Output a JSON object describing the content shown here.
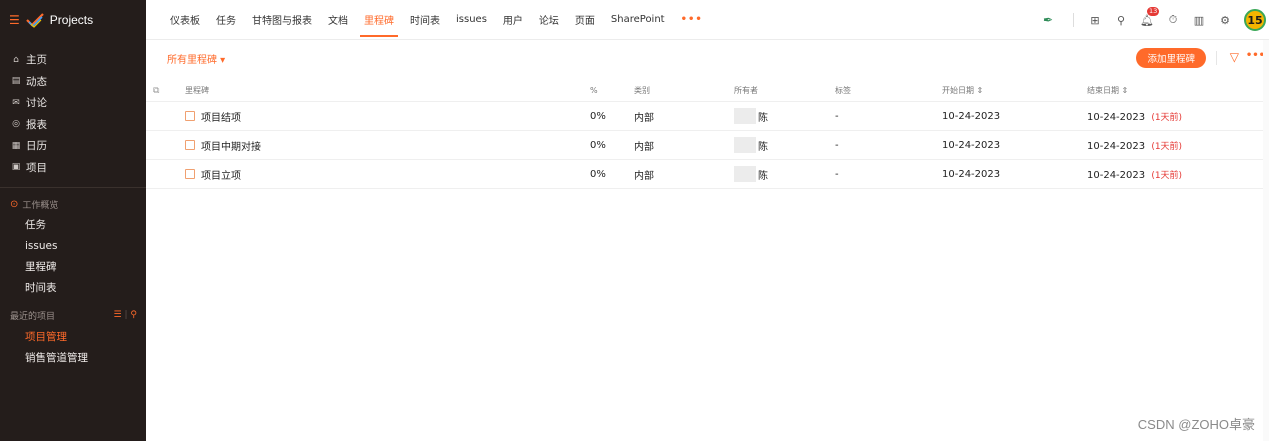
{
  "brand": {
    "name": "Projects"
  },
  "sidebar": {
    "nav": [
      {
        "icon": "home-icon",
        "glyph": "⌂",
        "label": "主页"
      },
      {
        "icon": "activity-icon",
        "glyph": "▤",
        "label": "动态"
      },
      {
        "icon": "discussion-icon",
        "glyph": "✉",
        "label": "讨论"
      },
      {
        "icon": "report-icon",
        "glyph": "◎",
        "label": "报表"
      },
      {
        "icon": "calendar-icon",
        "glyph": "▦",
        "label": "日历"
      },
      {
        "icon": "project-icon",
        "glyph": "▣",
        "label": "项目"
      }
    ],
    "work_overview": {
      "label": "工作概览",
      "items": [
        "任务",
        "issues",
        "里程碑",
        "时间表"
      ]
    },
    "recent": {
      "label": "最近的项目",
      "items": [
        "项目管理",
        "销售管道管理"
      ]
    }
  },
  "topnav": {
    "tabs": [
      "仪表板",
      "任务",
      "甘特图与报表",
      "文档",
      "里程碑",
      "时间表",
      "issues",
      "用户",
      "论坛",
      "页面",
      "SharePoint"
    ],
    "active": "里程碑",
    "more": "•••",
    "notification_count": "13",
    "avatar_text": "15"
  },
  "toolbar": {
    "filter_label": "所有里程碑 ▾",
    "add_button": "添加里程碑"
  },
  "table": {
    "headers": {
      "name": "里程碑",
      "percent": "%",
      "type": "类别",
      "owner": "所有者",
      "tags": "标签",
      "start": "开始日期 ⇕",
      "end": "结束日期 ⇕"
    },
    "rows": [
      {
        "name": "项目结项",
        "percent": "0%",
        "type": "内部",
        "owner": "陈",
        "tags": "-",
        "start": "10-24-2023",
        "end": "10-24-2023",
        "overdue": "(1天前)"
      },
      {
        "name": "项目中期对接",
        "percent": "0%",
        "type": "内部",
        "owner": "陈",
        "tags": "-",
        "start": "10-24-2023",
        "end": "10-24-2023",
        "overdue": "(1天前)"
      },
      {
        "name": "项目立项",
        "percent": "0%",
        "type": "内部",
        "owner": "陈",
        "tags": "-",
        "start": "10-24-2023",
        "end": "10-24-2023",
        "overdue": "(1天前)"
      }
    ]
  },
  "watermark": "CSDN @ZOHO卓豪",
  "colors": {
    "accent": "#ff6a2a",
    "sidebar_bg": "#241d1b",
    "overdue": "#e53935"
  }
}
